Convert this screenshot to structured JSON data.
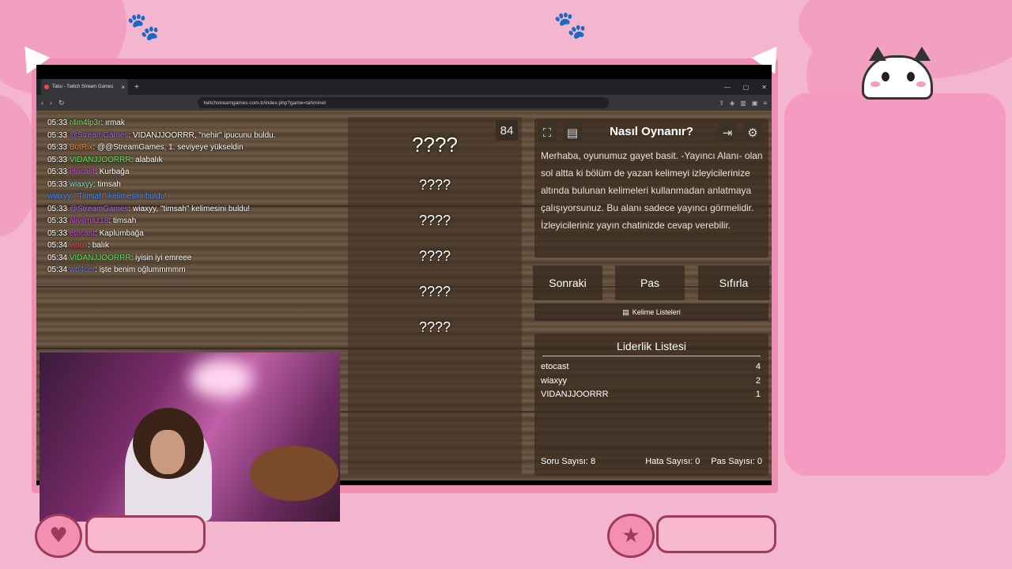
{
  "browser": {
    "tab_title": "Tabu - Twitch Stream Games",
    "url": "twitchstreamgames.com.tr/index.php?game=tahminet"
  },
  "chat": [
    {
      "time": "05:33",
      "user": "r4m4lp3r",
      "color": "#7fe36a",
      "message": "ırmak"
    },
    {
      "time": "05:33",
      "user": "@StreamGames",
      "color": "#a16ce0",
      "message": "VIDANJJOORRR, \"nehir\" ipucunu buldu."
    },
    {
      "time": "05:33",
      "user": "BotRix",
      "color": "#f08a3c",
      "message": "@@StreamGames, 1. seviyeye yükseldin"
    },
    {
      "time": "05:33",
      "user": "VIDANJJOORRR",
      "color": "#5ee05e",
      "message": "alabalık"
    },
    {
      "time": "05:33",
      "user": "etocast",
      "color": "#c94fe0",
      "message": "Kurbağa"
    },
    {
      "time": "05:33",
      "user": "wiaxyy",
      "color": "#7fe3d0",
      "message": "timsah"
    },
    {
      "time": "",
      "user": "wiaxyy,",
      "color": "#4d8fff",
      "message": "\"Timsah\" kelimesini buldu!",
      "system": true
    },
    {
      "time": "05:33",
      "user": "@StreamGames",
      "color": "#a16ce0",
      "message": "wiaxyy, \"timsah\" kelimesini buldu!"
    },
    {
      "time": "05:33",
      "user": "aliyilmaz18",
      "color": "#c94fe0",
      "message": "timsah"
    },
    {
      "time": "05:33",
      "user": "etocast",
      "color": "#c94fe0",
      "message": "Kaplumbağa"
    },
    {
      "time": "05:34",
      "user": "viodit",
      "color": "#e04848",
      "message": "balık"
    },
    {
      "time": "05:34",
      "user": "VIDANJJOORRR",
      "color": "#5ee05e",
      "message": "iyisin iyi emreee"
    },
    {
      "time": "05:34",
      "user": "wb4cer",
      "color": "#6a7be0",
      "message": "işte benim oğlummmmm"
    }
  ],
  "cards": {
    "main": "????",
    "hints": [
      "????",
      "????",
      "????",
      "????",
      "????"
    ],
    "counter": "84"
  },
  "howto": {
    "title": "Nasıl Oynanır?",
    "text": "Merhaba, oyunumuz gayet basit. -Yayıncı Alanı- olan sol altta ki bölüm de yazan kelimeyi izleyicilerinize altında bulunan kelimeleri kullanmadan anlatmaya çalışıyorsunuz. Bu alanı sadece yayıncı görmelidir. İzleyicileriniz yayın chatinizde cevap verebilir."
  },
  "actions": {
    "next": "Sonraki",
    "pass": "Pas",
    "reset": "Sıfırla",
    "word_lists": "Kelime Listeleri"
  },
  "leaderboard": {
    "title": "Liderlik Listesi",
    "rows": [
      {
        "name": "etocast",
        "score": "4"
      },
      {
        "name": "wiaxyy",
        "score": "2"
      },
      {
        "name": "VIDANJJOORRR",
        "score": "1"
      }
    ]
  },
  "stats": {
    "questions": "Soru Sayısı: 8",
    "errors": "Hata Sayısı: 0",
    "passes": "Pas Sayısı: 0"
  },
  "icons": {
    "fullscreen": "expand-icon",
    "list": "list-icon",
    "exit": "exit-icon",
    "settings": "gear-icon"
  },
  "colors": {
    "background_pink": "#f4b6cf",
    "frame_pink": "#ee8fb2",
    "wood": "#6e5a45"
  }
}
